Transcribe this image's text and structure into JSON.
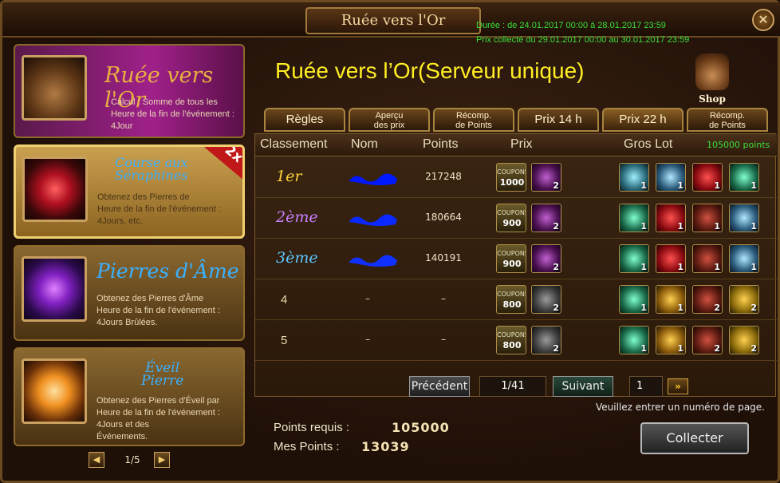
{
  "window": {
    "title": "Ruée vers l'Or",
    "date_line_1": "Durée : de 24.01.2017 00:00 à 28.01.2017 23:59",
    "date_line_2": "Prix collecté du 29.01.2017 00:00 au 30.01.2017 23:59",
    "close_symbol": "✕"
  },
  "events": [
    {
      "title": "Ruée vers l'Or",
      "desc_line_1": "Calcul : Somme de tous les",
      "desc_line_2": "Heure de la fin de l'événement :",
      "desc_line_3": "4Jour",
      "selected": false,
      "accent": "#f0c050"
    },
    {
      "title_line_1": "Course aux",
      "title_line_2": "Séraphines",
      "badge": "2x",
      "desc_line_1": "Obtenez des Pierres de",
      "desc_line_2": "Heure de la fin de l'événement :",
      "desc_line_3": "4Jours, etc.",
      "selected": true,
      "accent": "#3cb8ff"
    },
    {
      "title": "Pierres d'Âme",
      "desc_line_1": "Obtenez des Pierres d'Âme",
      "desc_line_2": "Heure de la fin de l'événement :",
      "desc_line_3": "4Jours Brûlées.",
      "selected": false,
      "accent": "#3cb8ff"
    },
    {
      "title_line_1": "Éveil",
      "title_line_2": "Pierre",
      "desc_line_1": "Obtenez des Pierres d'Éveil par",
      "desc_line_2": "Heure de la fin de l'événement :",
      "desc_line_3": "4Jours et des",
      "desc_line_4": "Événements.",
      "selected": false,
      "accent": "#3cb8ff"
    }
  ],
  "left_pager": {
    "prev": "◀",
    "text": "1/5",
    "next": "▶"
  },
  "main": {
    "title": "Ruée vers l’Or(Serveur unique)",
    "shop_label": "Shop",
    "tabs": [
      {
        "line_1": "Règles",
        "line_2": ""
      },
      {
        "line_1": "Aperçu",
        "line_2": "des prix"
      },
      {
        "line_1": "Récomp.",
        "line_2": "de Points"
      },
      {
        "line_1": "Prix 14 h",
        "line_2": ""
      },
      {
        "line_1": "Prix 22 h",
        "line_2": ""
      },
      {
        "line_1": "Récomp.",
        "line_2": "de Points"
      }
    ],
    "table": {
      "headers": {
        "rank": "Classement",
        "name": "Nom",
        "points": "Points",
        "prize": "Prix",
        "jackpot": "Gros Lot",
        "jackpot_points": "105000 points"
      },
      "rows": [
        {
          "rank": "1er",
          "rank_color": "#ffd23a",
          "name": "",
          "points": "217248",
          "coupon": "1000",
          "bonus_count": "2",
          "bonus_type": "purple-bag",
          "jackpot": [
            "1",
            "1",
            "1",
            "1"
          ]
        },
        {
          "rank": "2ème",
          "rank_color": "#c880ff",
          "name": "",
          "points": "180664",
          "coupon": "900",
          "bonus_count": "2",
          "bonus_type": "purple-bag",
          "jackpot": [
            "1",
            "1",
            "1",
            "1"
          ]
        },
        {
          "rank": "3ème",
          "rank_color": "#5ac8ff",
          "name": "",
          "points": "140191",
          "coupon": "900",
          "bonus_count": "2",
          "bonus_type": "purple-bag",
          "jackpot": [
            "1",
            "1",
            "1",
            "1"
          ]
        },
        {
          "rank": "4",
          "rank_color": "#e8d9b0",
          "name": "–",
          "points": "–",
          "coupon": "800",
          "bonus_count": "2",
          "bonus_type": "chest",
          "jackpot": [
            "1",
            "1",
            "2",
            "2"
          ]
        },
        {
          "rank": "5",
          "rank_color": "#e8d9b0",
          "name": "–",
          "points": "–",
          "coupon": "800",
          "bonus_count": "2",
          "bonus_type": "chest",
          "jackpot": [
            "1",
            "1",
            "2",
            "2"
          ]
        }
      ],
      "coupon_label": "COUPONS"
    },
    "pager": {
      "prev_label": "Précédent",
      "page_text": "1/41",
      "next_label": "Suivant",
      "page_input": "1",
      "go_symbol": "»",
      "hint": "Veuillez entrer un numéro de page."
    },
    "stats": {
      "required_label": "Points requis :",
      "required_value": "105000",
      "mine_label": "Mes Points :",
      "mine_value": "13039"
    },
    "collect_label": "Collecter"
  }
}
